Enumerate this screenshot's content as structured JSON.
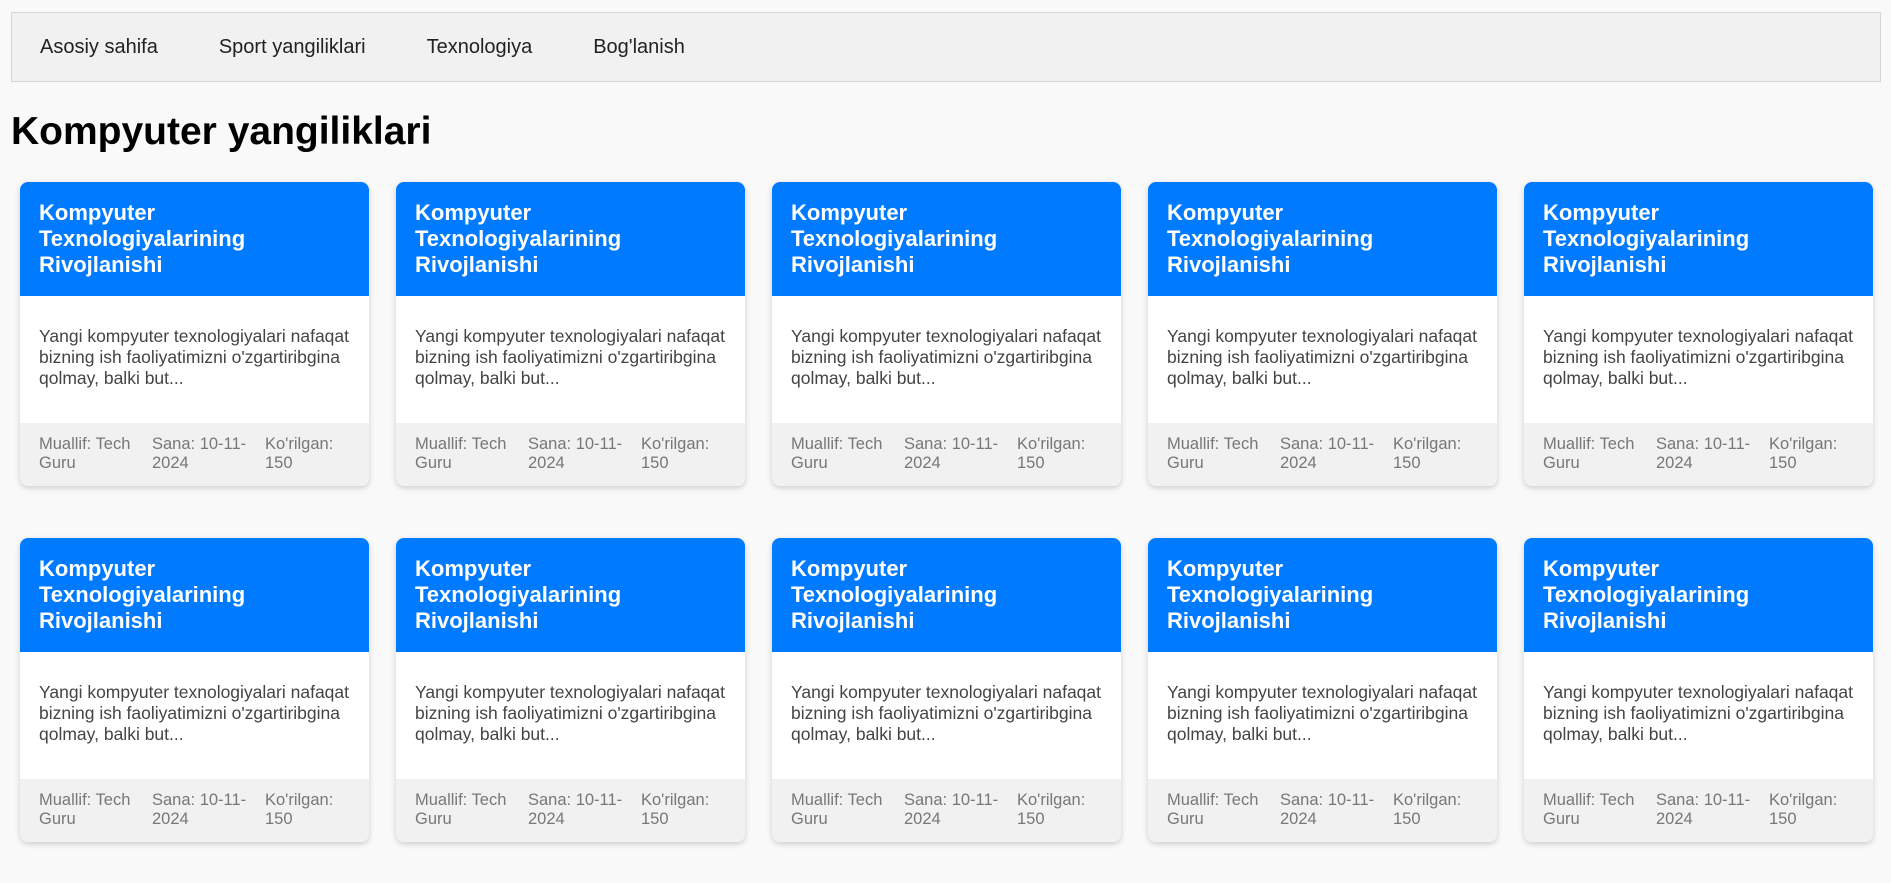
{
  "nav": {
    "items": [
      "Asosiy sahifa",
      "Sport yangiliklari",
      "Texnologiya",
      "Bog'lanish"
    ]
  },
  "page": {
    "title": "Kompyuter yangiliklari"
  },
  "colors": {
    "accent": "#007bff",
    "background": "#f9f9f9",
    "footer": "#f1f1f1"
  },
  "cards": [
    {
      "title": "Kompyuter Texnologiyalarining Rivojlanishi",
      "excerpt": "Yangi kompyuter texnologiyalari nafaqat bizning ish faoliyatimizni o'zgartiribgina qolmay, balki but...",
      "author": "Muallif: Tech Guru",
      "date": "Sana: 10-11-2024",
      "views": "Ko'rilgan: 150"
    },
    {
      "title": "Kompyuter Texnologiyalarining Rivojlanishi",
      "excerpt": "Yangi kompyuter texnologiyalari nafaqat bizning ish faoliyatimizni o'zgartiribgina qolmay, balki but...",
      "author": "Muallif: Tech Guru",
      "date": "Sana: 10-11-2024",
      "views": "Ko'rilgan: 150"
    },
    {
      "title": "Kompyuter Texnologiyalarining Rivojlanishi",
      "excerpt": "Yangi kompyuter texnologiyalari nafaqat bizning ish faoliyatimizni o'zgartiribgina qolmay, balki but...",
      "author": "Muallif: Tech Guru",
      "date": "Sana: 10-11-2024",
      "views": "Ko'rilgan: 150"
    },
    {
      "title": "Kompyuter Texnologiyalarining Rivojlanishi",
      "excerpt": "Yangi kompyuter texnologiyalari nafaqat bizning ish faoliyatimizni o'zgartiribgina qolmay, balki but...",
      "author": "Muallif: Tech Guru",
      "date": "Sana: 10-11-2024",
      "views": "Ko'rilgan: 150"
    },
    {
      "title": "Kompyuter Texnologiyalarining Rivojlanishi",
      "excerpt": "Yangi kompyuter texnologiyalari nafaqat bizning ish faoliyatimizni o'zgartiribgina qolmay, balki but...",
      "author": "Muallif: Tech Guru",
      "date": "Sana: 10-11-2024",
      "views": "Ko'rilgan: 150"
    },
    {
      "title": "Kompyuter Texnologiyalarining Rivojlanishi",
      "excerpt": "Yangi kompyuter texnologiyalari nafaqat bizning ish faoliyatimizni o'zgartiribgina qolmay, balki but...",
      "author": "Muallif: Tech Guru",
      "date": "Sana: 10-11-2024",
      "views": "Ko'rilgan: 150"
    },
    {
      "title": "Kompyuter Texnologiyalarining Rivojlanishi",
      "excerpt": "Yangi kompyuter texnologiyalari nafaqat bizning ish faoliyatimizni o'zgartiribgina qolmay, balki but...",
      "author": "Muallif: Tech Guru",
      "date": "Sana: 10-11-2024",
      "views": "Ko'rilgan: 150"
    },
    {
      "title": "Kompyuter Texnologiyalarining Rivojlanishi",
      "excerpt": "Yangi kompyuter texnologiyalari nafaqat bizning ish faoliyatimizni o'zgartiribgina qolmay, balki but...",
      "author": "Muallif: Tech Guru",
      "date": "Sana: 10-11-2024",
      "views": "Ko'rilgan: 150"
    },
    {
      "title": "Kompyuter Texnologiyalarining Rivojlanishi",
      "excerpt": "Yangi kompyuter texnologiyalari nafaqat bizning ish faoliyatimizni o'zgartiribgina qolmay, balki but...",
      "author": "Muallif: Tech Guru",
      "date": "Sana: 10-11-2024",
      "views": "Ko'rilgan: 150"
    },
    {
      "title": "Kompyuter Texnologiyalarining Rivojlanishi",
      "excerpt": "Yangi kompyuter texnologiyalari nafaqat bizning ish faoliyatimizni o'zgartiribgina qolmay, balki but...",
      "author": "Muallif: Tech Guru",
      "date": "Sana: 10-11-2024",
      "views": "Ko'rilgan: 150"
    }
  ]
}
